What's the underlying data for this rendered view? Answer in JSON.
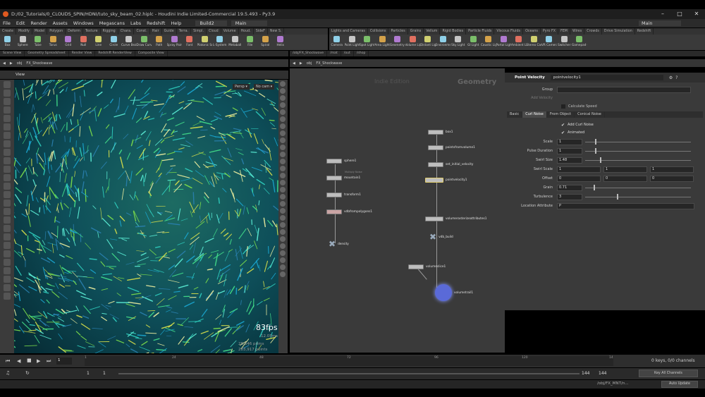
{
  "window": {
    "title": "D:/02_Tutorials/0_CLOUDS_SPIN/HDNI/tuto_sky_beam_02.hiplc - Houdini Indie Limited-Commercial 19.5.493 - Py3.9"
  },
  "menu": [
    "File",
    "Edit",
    "Render",
    "Assets",
    "Windows",
    "Megascans",
    "Labs",
    "Redshift",
    "Help"
  ],
  "desktop": {
    "build": "Build2",
    "main": "Main",
    "main_right": "Main"
  },
  "shelf_tabs_left": [
    "Create",
    "Modify",
    "Model",
    "Polygon",
    "Deform",
    "Texture",
    "Rigging",
    "Chara.",
    "Const.",
    "Hair",
    "Guide",
    "Terra.",
    "Simpl.",
    "Cloud",
    "Volume",
    "Houd.",
    "SideF",
    "New S."
  ],
  "shelf_tabs_right": [
    "Lights and Cameras",
    "Collisions",
    "Particles",
    "Grains",
    "Vellum",
    "Rigid Bodies",
    "Particle Fluids",
    "Viscous Fluids",
    "Oceans",
    "Pyro FX",
    "FEM",
    "Wires",
    "Crowds",
    "Drive Simulation",
    "Redshift"
  ],
  "shelf_tools_left": [
    "Box",
    "Sphere",
    "Tube",
    "Torus",
    "Grid",
    "Null",
    "Line",
    "Circle",
    "Curve Bezier",
    "Draw Curve",
    "Path",
    "Spray Paint",
    "Font",
    "Platonic Solids",
    "L-System",
    "Metaball",
    "File",
    "Spiral",
    "Helix"
  ],
  "shelf_tools_right": [
    "Camera",
    "Point Light",
    "Spot Light",
    "Area Light",
    "Geometry Light",
    "Volume Light",
    "Distant Light",
    "Environment Light",
    "Sky Light",
    "GI Light",
    "Caustic Light",
    "Portal Light",
    "Ambient Light",
    "Stereo Camera",
    "VR Camera",
    "Switcher",
    "Gamepad Camera"
  ],
  "pane_tabs_left": [
    "Scene View",
    "Geometry Spreadsheet",
    "Render View",
    "Redshift RenderView",
    "Composite View"
  ],
  "pane_tabs_right": [
    "/obj/FX_Shockwave",
    "/mat",
    "/out",
    "/shop"
  ],
  "path": {
    "obj": "obj",
    "node": "FX_Shockwave"
  },
  "viewport": {
    "label": "View",
    "persp": "Persp ▾",
    "cam": "No cam ▾",
    "fps": "83fps",
    "ms": "12.05ms",
    "prims": "28,546  prims",
    "points": "283,917  points"
  },
  "network": {
    "watermark_left": "Indie Edition",
    "watermark_right": "Geometry",
    "nodes": [
      "sphere1",
      "mountain1",
      "transform1",
      "vdbfrompolygons1",
      "density",
      "box1",
      "pointsfromvolume1",
      "set_initial_velocity",
      "pointvelocity1",
      "volumerasterizeattributes1",
      "vdb_build",
      "volumeslice1",
      "volumetrail1"
    ],
    "node_notes": [
      "",
      "Multiply Noise",
      "",
      "",
      "",
      "",
      "",
      "",
      "",
      "",
      "",
      "",
      ""
    ]
  },
  "param": {
    "type": "Point Velocity",
    "name": "pointvelocity1",
    "group_label": "Group",
    "add_velocity_label": "Add Velocity",
    "calc_speed": "Calculate Speed",
    "tabs": [
      "Basic",
      "Curl Noise",
      "From Object",
      "Conical Noise"
    ],
    "add_curl_noise": "Add Curl Noise",
    "animated": "Animated",
    "rows": [
      {
        "label": "Scale",
        "value": "1"
      },
      {
        "label": "Pulse Duration",
        "value": "1"
      },
      {
        "label": "Swirl Size",
        "value": "1.48"
      },
      {
        "label": "Swirl Scale",
        "value": "1",
        "v2": "1",
        "v3": "1"
      },
      {
        "label": "Offset",
        "value": "0",
        "v2": "0",
        "v3": "0"
      },
      {
        "label": "Grain",
        "value": "0.71"
      },
      {
        "label": "Turbulence",
        "value": "3"
      },
      {
        "label": "Location Attribute",
        "value": "P"
      }
    ]
  },
  "timeline": {
    "ticks": [
      "1",
      "24",
      "48",
      "72",
      "96",
      "120",
      "14"
    ],
    "frame": "1",
    "start": "1",
    "start2": "1",
    "end": "144",
    "end2": "144"
  },
  "keys": {
    "channels": "0 keys, 0/0 channels",
    "all": "Key All Channels"
  },
  "status": {
    "path": "/obj/FX_MNT/n...",
    "update": "Auto Update"
  }
}
